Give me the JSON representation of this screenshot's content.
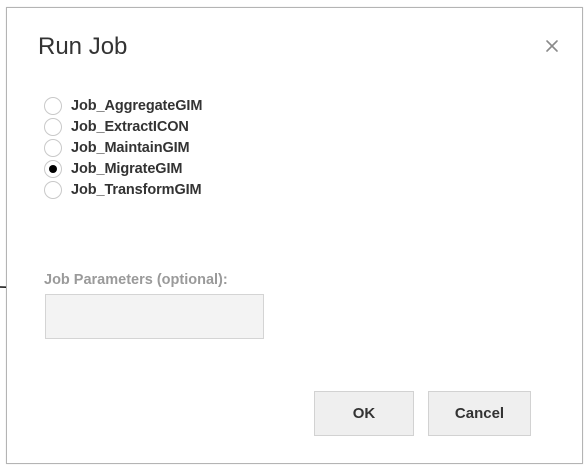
{
  "dialog": {
    "title": "Run Job",
    "close_icon": "close-icon"
  },
  "jobs": {
    "selected": "Job_MigrateGIM",
    "options": [
      {
        "label": "Job_AggregateGIM",
        "checked": false
      },
      {
        "label": "Job_ExtractICON",
        "checked": false
      },
      {
        "label": "Job_MaintainGIM",
        "checked": false
      },
      {
        "label": "Job_MigrateGIM",
        "checked": true
      },
      {
        "label": "Job_TransformGIM",
        "checked": false
      }
    ]
  },
  "parameters": {
    "label": "Job Parameters (optional):",
    "value": ""
  },
  "buttons": {
    "ok_label": "OK",
    "cancel_label": "Cancel"
  },
  "annotation": {
    "icon": "arrow-right-icon"
  }
}
